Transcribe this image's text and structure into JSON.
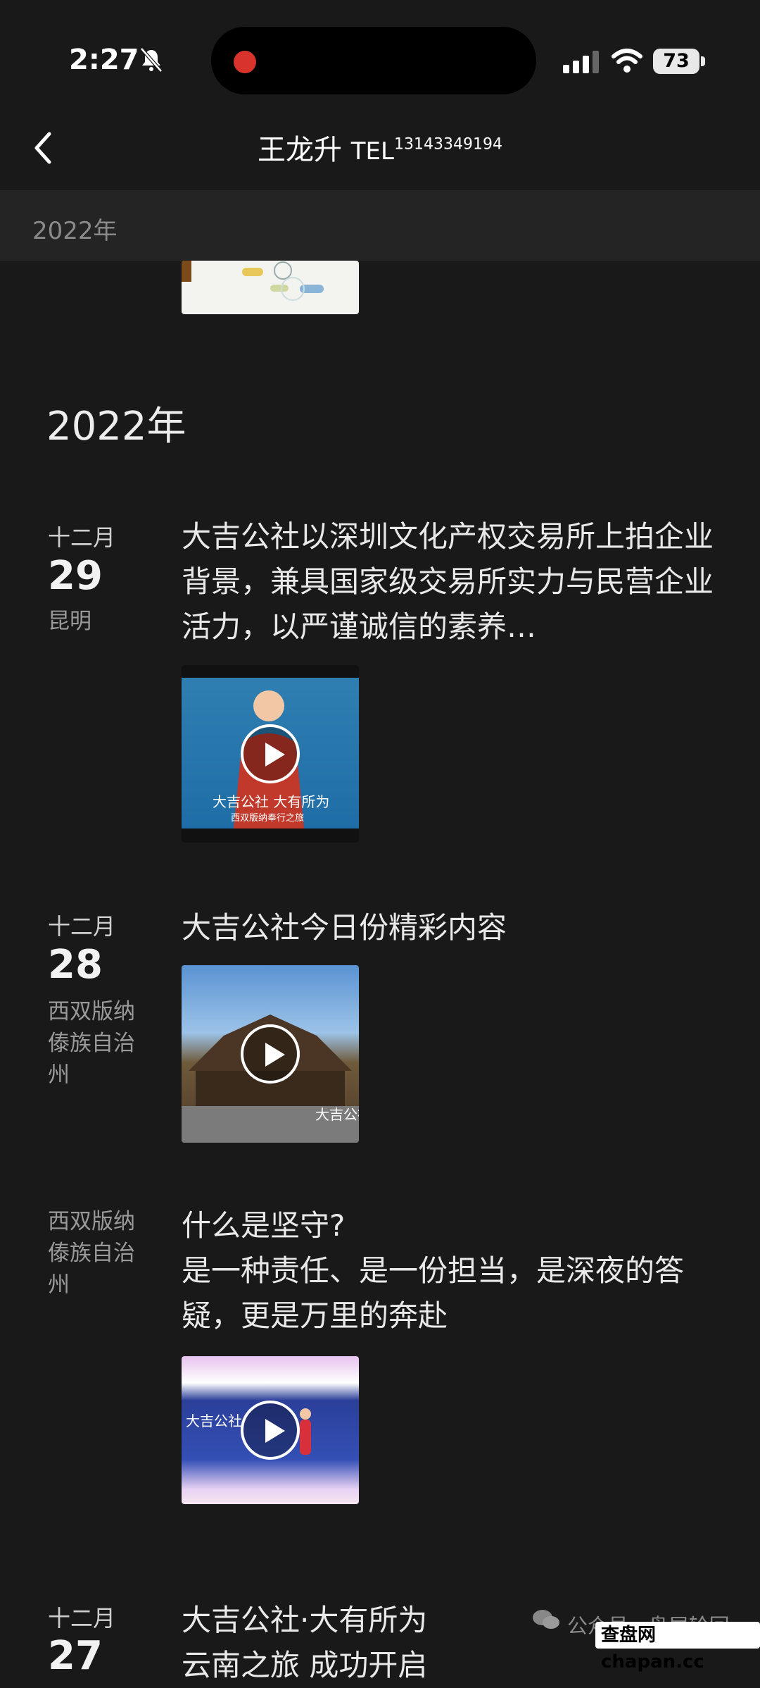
{
  "status_bar": {
    "time": "2:27",
    "battery": "73"
  },
  "header": {
    "name": "王龙升",
    "tel_prefix": "TEL",
    "tel_number": "13143349194"
  },
  "sticky_year": "2022年",
  "section_year": "2022年",
  "posts": [
    {
      "month": "十二月",
      "day": "29",
      "location": "昆明",
      "text": "大吉公社以深圳文化产权交易所上拍企业背景，兼具国家级交易所实力与民营企业活力，以严谨诚信的素养…",
      "thumb_caption": "大吉公社 大有所为",
      "thumb_sub": "西双版纳奉行之旅"
    },
    {
      "month": "十二月",
      "day": "28",
      "location": "西双版纳傣族自治州",
      "text": "大吉公社今日份精彩内容",
      "thumb_caption": "大吉公社"
    },
    {
      "month": "",
      "day": "",
      "location": "西双版纳傣族自治州",
      "text_line1": "什么是坚守?",
      "text_line2": "是一种责任、是一份担当，是深夜的答疑，更是万里的奔赴",
      "thumb_caption": "大吉公社"
    },
    {
      "month": "十二月",
      "day": "27",
      "location": "",
      "text": "大吉公社·大有所为",
      "text2": "云南之旅 成功开启"
    }
  ],
  "watermark": {
    "text": "公众号 · 盘居轮回",
    "badge": "查盘网 chapan.cc"
  },
  "colors": {
    "background": "#191919",
    "sticky": "#242424",
    "record_dot": "#d9342b"
  }
}
